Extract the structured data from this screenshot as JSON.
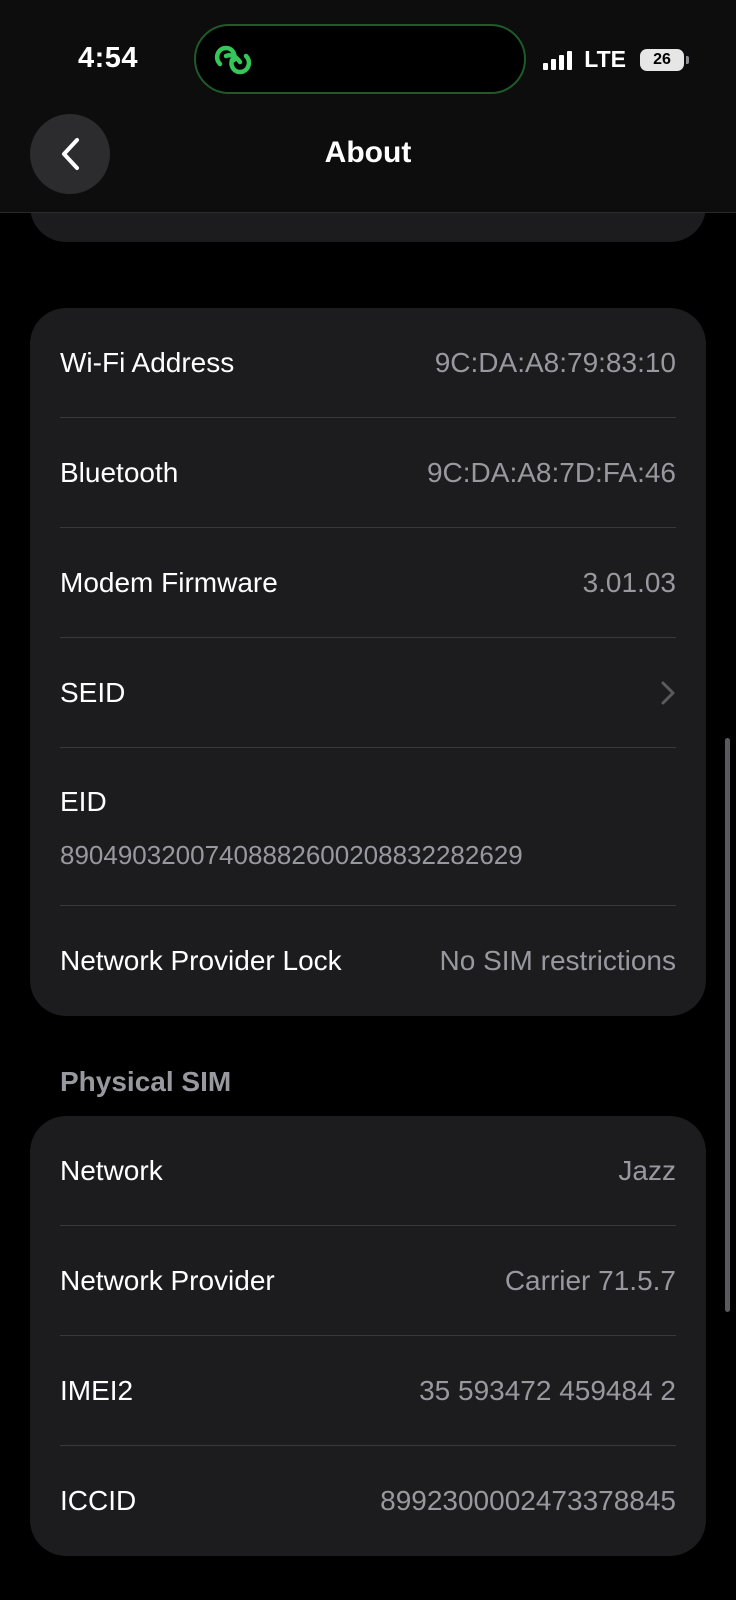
{
  "status_bar": {
    "time": "4:54",
    "network": "LTE",
    "battery": "26"
  },
  "nav": {
    "title": "About",
    "back_icon": "chevron-left-icon"
  },
  "info_card": {
    "rows": [
      {
        "label": "Wi-Fi Address",
        "value": "9C:DA:A8:79:83:10"
      },
      {
        "label": "Bluetooth",
        "value": "9C:DA:A8:7D:FA:46"
      },
      {
        "label": "Modem Firmware",
        "value": "3.01.03"
      },
      {
        "label": "SEID",
        "value": ""
      },
      {
        "label": "EID",
        "value": "89049032007408882600208832282629"
      },
      {
        "label": "Network Provider Lock",
        "value": "No SIM restrictions"
      }
    ]
  },
  "sim_section": {
    "header": "Physical SIM",
    "rows": [
      {
        "label": "Network",
        "value": "Jazz"
      },
      {
        "label": "Network Provider",
        "value": "Carrier 71.5.7"
      },
      {
        "label": "IMEI2",
        "value": "35 593472 459484 2"
      },
      {
        "label": "ICCID",
        "value": "8992300002473378845"
      }
    ]
  },
  "colors": {
    "background": "#000000",
    "card": "#1c1c1e",
    "secondary_text": "#98989f",
    "accent_green": "#35c759"
  }
}
